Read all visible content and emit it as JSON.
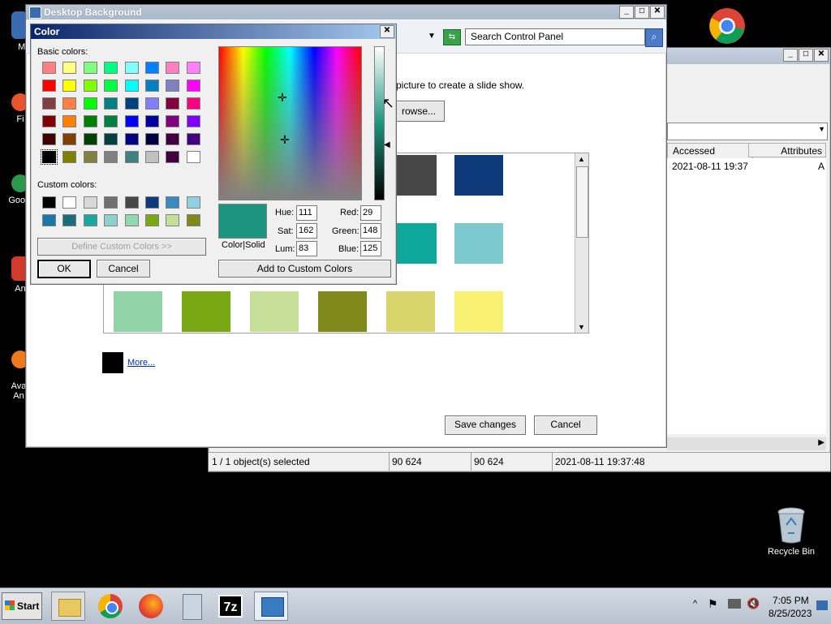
{
  "desktop": {
    "icons": [
      {
        "label": "My C",
        "color": "#3a6ab0"
      },
      {
        "label": "Fi",
        "color": "#e8552a"
      },
      {
        "label": "Googl",
        "color": "#2a9a4a"
      },
      {
        "label": "An",
        "color": "#d23a2a"
      },
      {
        "label": "Ava\nAn",
        "color": "#f07a1a"
      }
    ],
    "recycle_bin": "Recycle Bin"
  },
  "bg_window": {
    "title": "Desktop Background",
    "search_placeholder": "Search Control Panel",
    "instruction": "picture to create a slide show.",
    "browse_label": "rowse...",
    "more_label": "More...",
    "save_label": "Save changes",
    "cancel_label": "Cancel",
    "tiles": [
      "#474747",
      "#0e3a7c",
      "#0ea89c",
      "#7ccad0",
      "#8fd3a6",
      "#78a814",
      "#c6df98",
      "#82891c",
      "#d8d46c",
      "#f8f070"
    ]
  },
  "explorer": {
    "col_accessed": "Accessed",
    "col_attributes": "Attributes",
    "row_accessed": "2021-08-11 19:37",
    "row_attr": "A",
    "status": [
      "1 / 1 object(s) selected",
      "90 624",
      "90 624",
      "2021-08-11 19:37:48"
    ]
  },
  "color_dialog": {
    "title": "Color",
    "basic_label": "Basic colors:",
    "custom_label": "Custom colors:",
    "define_label": "Define Custom Colors >>",
    "ok_label": "OK",
    "cancel_label": "Cancel",
    "add_label": "Add to Custom Colors",
    "colorsolid_label": "Color|Solid",
    "hue_label": "Hue:",
    "hue": "111",
    "sat_label": "Sat:",
    "sat": "162",
    "lum_label": "Lum:",
    "lum": "83",
    "red_label": "Red:",
    "red": "29",
    "green_label": "Green:",
    "green": "148",
    "blue_label": "Blue:",
    "blue": "125",
    "current_color": "#1d947d",
    "basic_colors": [
      "#ff8080",
      "#ffff80",
      "#80ff80",
      "#00ff80",
      "#80ffff",
      "#0080ff",
      "#ff80c0",
      "#ff80ff",
      "#ff0000",
      "#ffff00",
      "#80ff00",
      "#00ff40",
      "#00ffff",
      "#0080c0",
      "#8080c0",
      "#ff00ff",
      "#804040",
      "#ff8040",
      "#00ff00",
      "#008080",
      "#004080",
      "#8080ff",
      "#800040",
      "#ff0080",
      "#800000",
      "#ff8000",
      "#008000",
      "#008040",
      "#0000ff",
      "#0000a0",
      "#800080",
      "#8000ff",
      "#400000",
      "#804000",
      "#004000",
      "#004040",
      "#000080",
      "#000040",
      "#400040",
      "#400080",
      "#000000",
      "#808000",
      "#808040",
      "#808080",
      "#408080",
      "#c0c0c0",
      "#400040",
      "#ffffff"
    ],
    "custom_colors": [
      "#000000",
      "#ffffff",
      "#d8d8d8",
      "#707070",
      "#474747",
      "#0e3a7c",
      "#3a8ac0",
      "#90d0e0",
      "#1a78a8",
      "#1a6e7a",
      "#1aa8a0",
      "#90d0cc",
      "#90d8b0",
      "#78a814",
      "#c6df98",
      "#82891c"
    ]
  },
  "taskbar": {
    "start_label": "Start",
    "time": "7:05 PM",
    "date": "8/25/2023"
  }
}
